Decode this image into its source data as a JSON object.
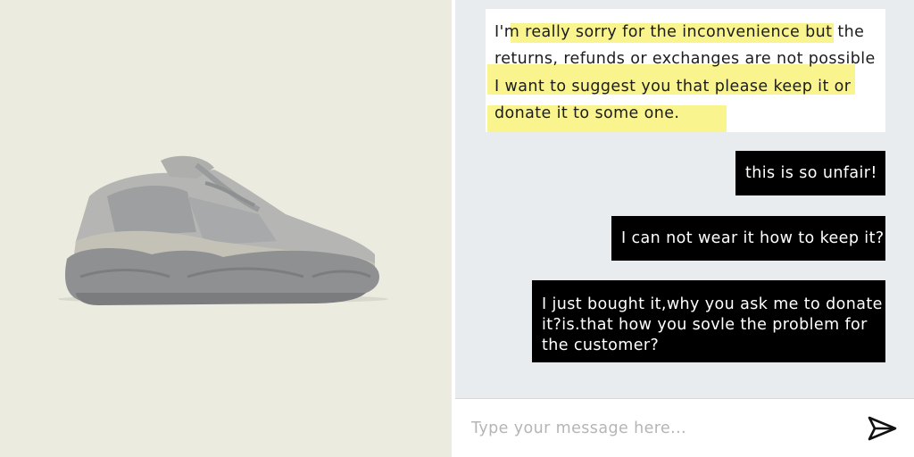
{
  "product": {
    "image_icon": "sneaker-product-image"
  },
  "chat": {
    "agent_message": {
      "lines": [
        "I'm really sorry for the inconvenience but the",
        "returns, refunds or exchanges  are not possible",
        "I want to suggest you that please keep it or",
        "donate it to some one."
      ],
      "highlight_color": "#f8f27a"
    },
    "user_messages": [
      {
        "lines": [
          "this is so unfair!"
        ]
      },
      {
        "lines": [
          "I can not wear it how to keep it?"
        ]
      },
      {
        "lines": [
          "I just bought it,why you ask me to donate",
          "it?is.that how you sovle the problem for",
          "the customer?"
        ]
      }
    ]
  },
  "composer": {
    "placeholder": "Type your message here...",
    "send_icon": "send-icon"
  }
}
